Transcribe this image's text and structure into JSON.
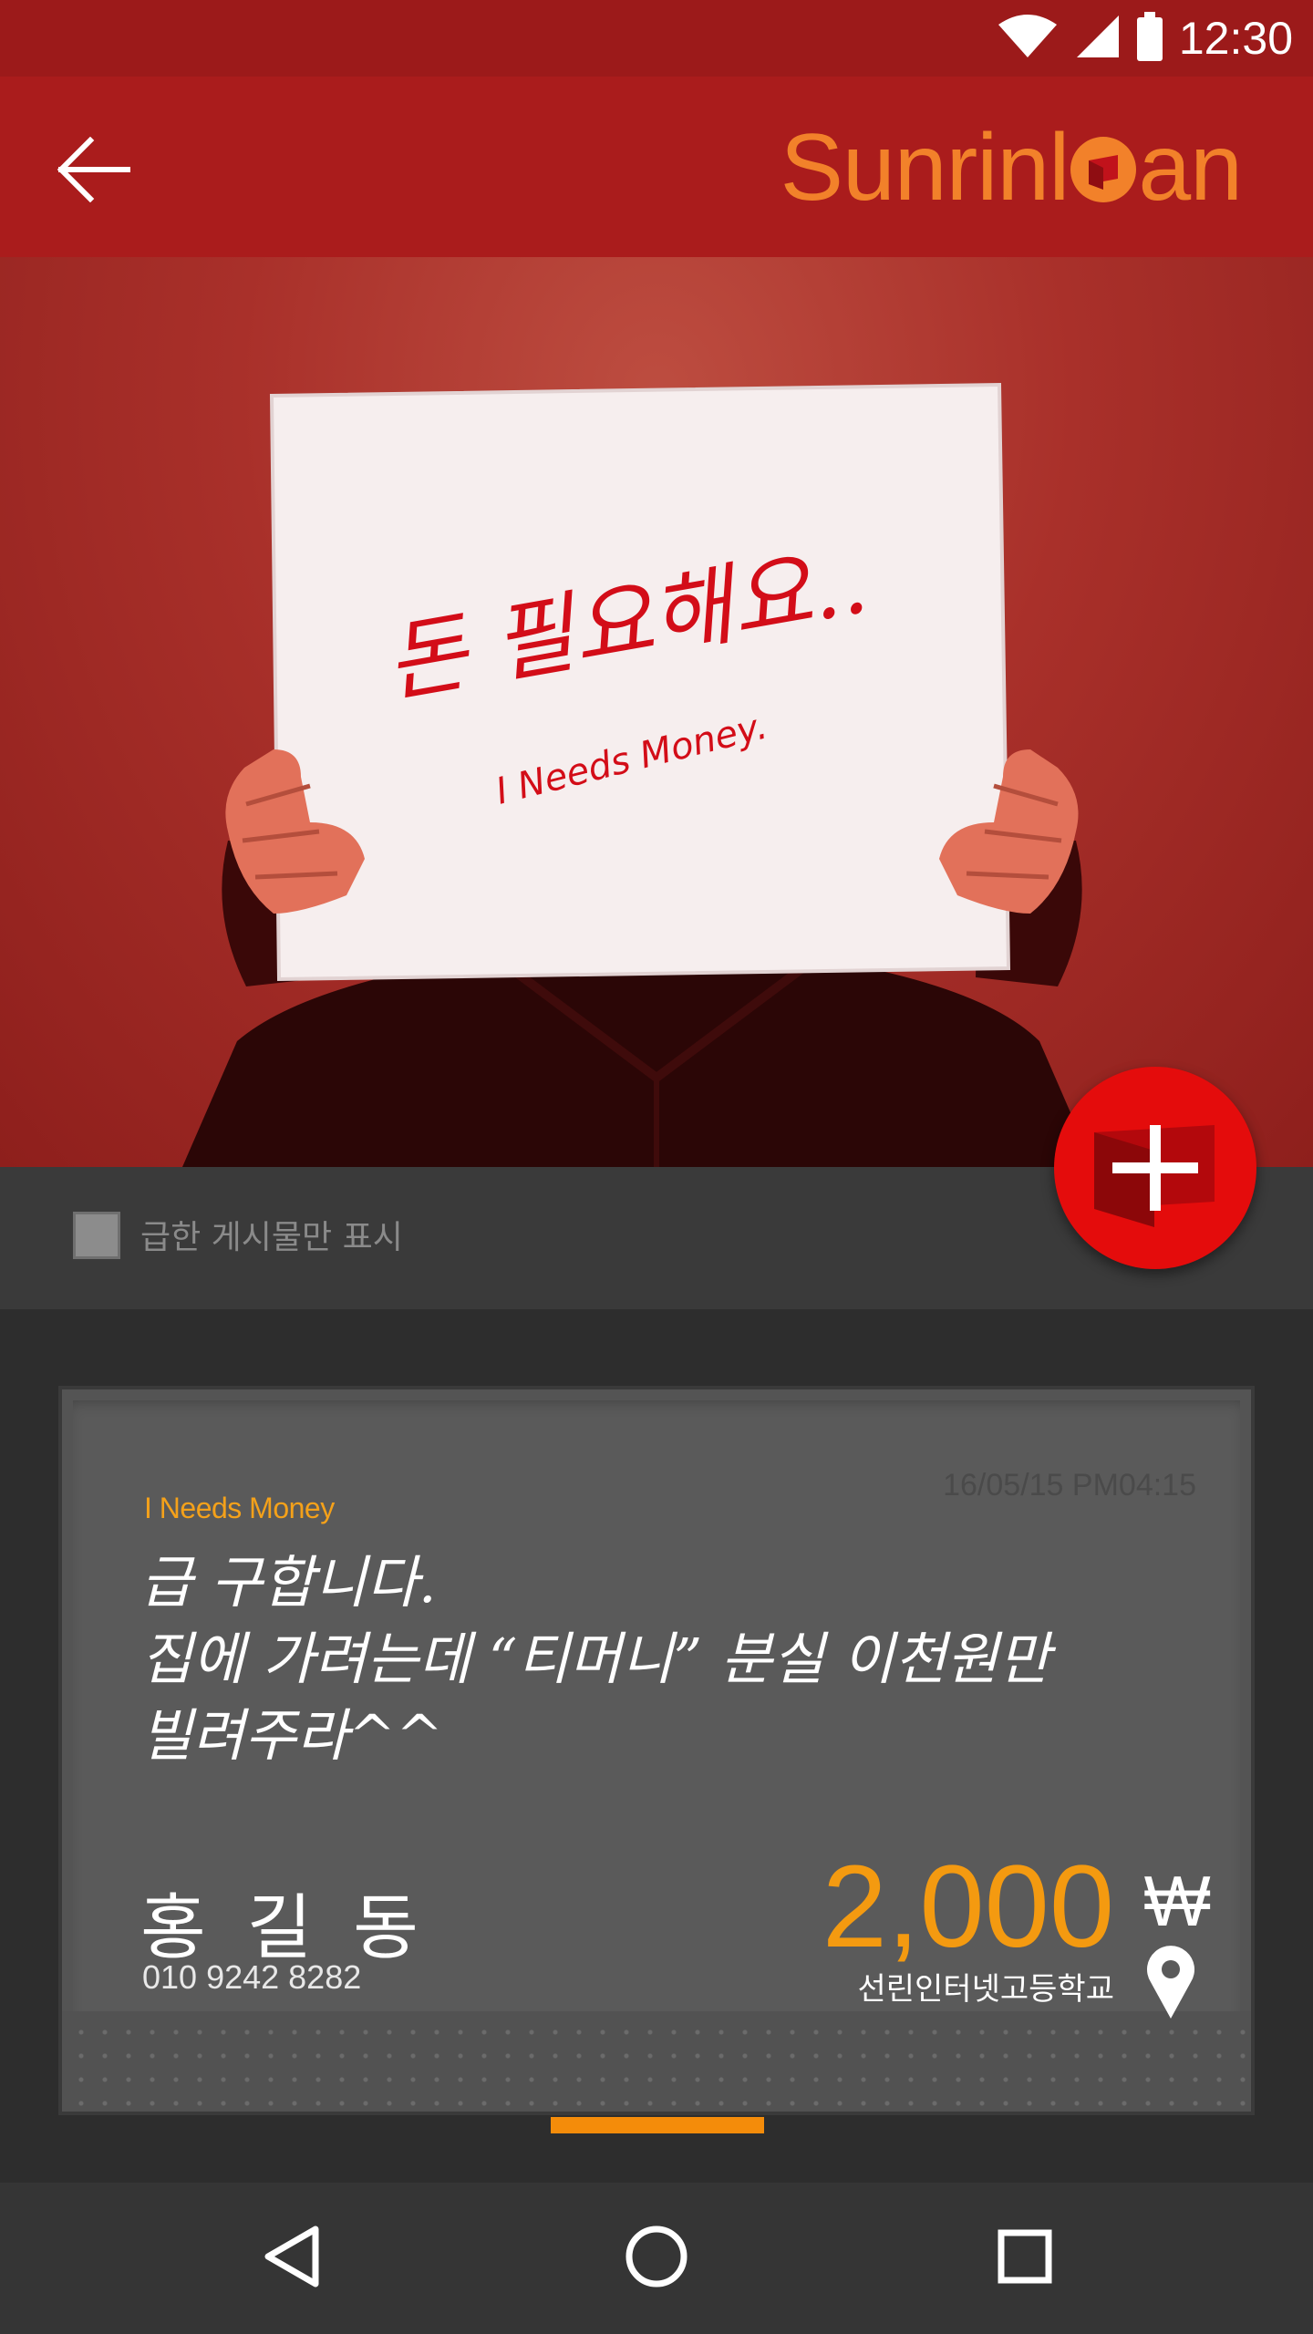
{
  "status_bar": {
    "time": "12:30",
    "icons": [
      "wifi-icon",
      "signal-icon",
      "battery-icon"
    ]
  },
  "app_bar": {
    "back_icon": "back-arrow-icon",
    "logo": "SunrinLoan",
    "logo_parts": {
      "before": "Sunrin",
      "after": "an"
    }
  },
  "hero": {
    "sign_text_korean": "돈 필요해요..",
    "sign_text_english": "I Needs Money."
  },
  "filter": {
    "checkbox_checked": false,
    "label": "급한 게시물만 표시"
  },
  "fab": {
    "icon": "plus-icon"
  },
  "card": {
    "date": "16/05/15 PM04:15",
    "tag": "I Needs Money",
    "message_lines": [
      "급 구합니다.",
      "집에 가려는데 “티머니” 분실 이천원만",
      "빌려주라^^"
    ],
    "name": "홍 길 동",
    "phone": "010 9242 8282",
    "amount": "2,000",
    "currency": "₩",
    "location": "선린인터넷고등학교",
    "location_icon": "location-pin-icon"
  },
  "nav_bar": {
    "icons": [
      "back-triangle-icon",
      "home-circle-icon",
      "recents-square-icon"
    ]
  },
  "colors": {
    "status_bar": "#9c1a1a",
    "app_bar": "#aa1c1c",
    "logo": "#f2812a",
    "accent_orange": "#f49a10",
    "fab": "#e40c0c",
    "card": "#5a5a5a"
  }
}
